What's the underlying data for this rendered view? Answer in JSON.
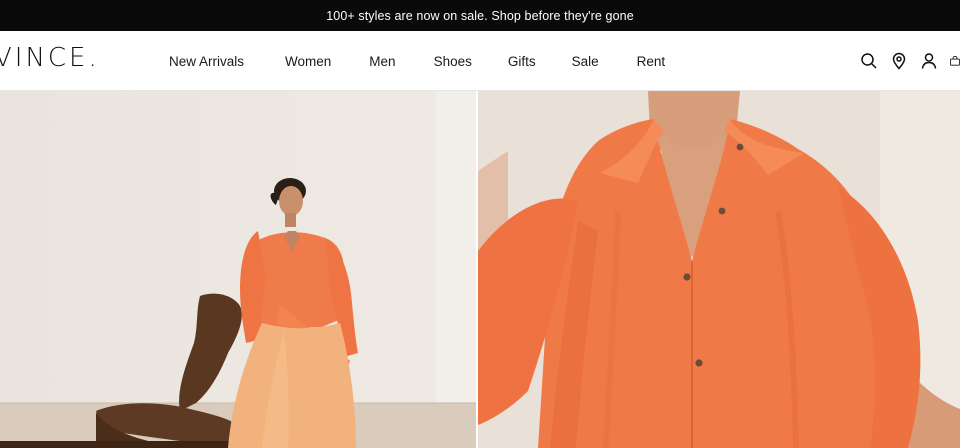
{
  "promo": {
    "text": "100+ styles are now on sale. Shop before they're gone"
  },
  "brand": {
    "logo": "VINCE."
  },
  "nav": {
    "items": [
      {
        "label": "New Arrivals"
      },
      {
        "label": "Women"
      },
      {
        "label": "Men"
      },
      {
        "label": "Shoes"
      },
      {
        "label": "Gifts"
      },
      {
        "label": "Sale"
      },
      {
        "label": "Rent"
      }
    ]
  },
  "header_icons": [
    "search-icon",
    "location-pin-icon",
    "account-icon",
    "shopping-bag-icon"
  ],
  "colors": {
    "promo_bg": "#0a0a0a",
    "garment_orange": "#f07b4a",
    "skirt_peach": "#f2b27d",
    "chair_brown": "#5e3a24"
  }
}
